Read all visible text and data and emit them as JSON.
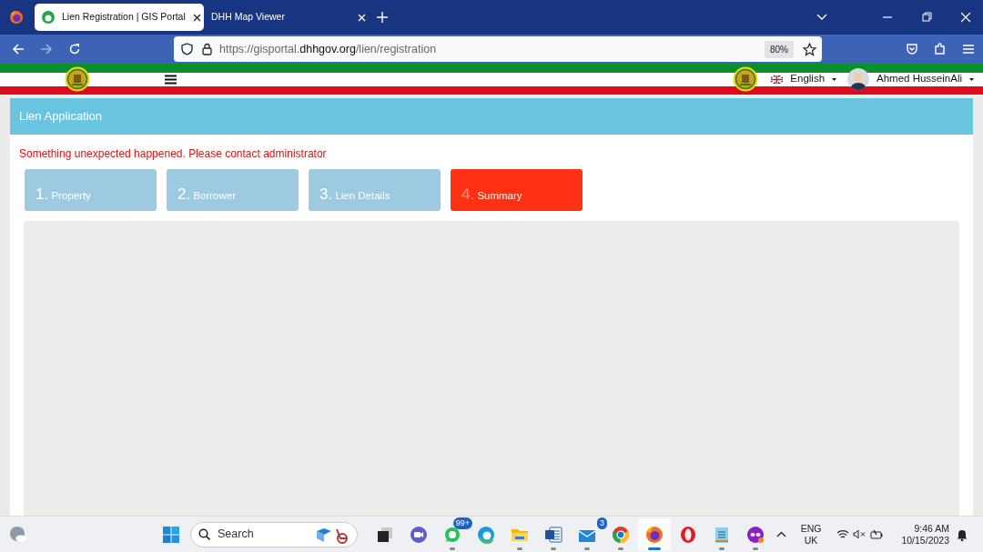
{
  "browser": {
    "tabs": [
      {
        "title": "Lien Registration | GIS Portal",
        "selected": true
      },
      {
        "title": "DHH Map Viewer",
        "selected": false
      }
    ],
    "url": {
      "prefix": "https://gisportal.",
      "domain": "dhhgov.org",
      "path": "/lien/registration"
    },
    "zoom": "80%"
  },
  "header": {
    "language": "English",
    "user": "Ahmed HusseinAli"
  },
  "card": {
    "title": "Lien Application",
    "error": "Something unexpected happened. Please contact administrator",
    "steps": [
      {
        "number": "1.",
        "label": "Property",
        "selected": false
      },
      {
        "number": "2.",
        "label": "Borrower",
        "selected": false
      },
      {
        "number": "3.",
        "label": "Lien Details",
        "selected": false
      },
      {
        "number": "4.",
        "label": "Summary",
        "selected": true
      }
    ]
  },
  "taskbar": {
    "search": "Search",
    "apps": [
      {
        "kind": "taskview",
        "running": false,
        "selected": false
      },
      {
        "kind": "meet",
        "running": false,
        "selected": false
      },
      {
        "kind": "whatsapp",
        "running": true,
        "selected": false,
        "badge": "99+"
      },
      {
        "kind": "edge",
        "running": false,
        "selected": false
      },
      {
        "kind": "folder",
        "running": true,
        "selected": false
      },
      {
        "kind": "word",
        "running": true,
        "selected": false
      },
      {
        "kind": "mail",
        "running": true,
        "selected": false,
        "badge": "3"
      },
      {
        "kind": "chrome",
        "running": true,
        "selected": false
      },
      {
        "kind": "firefox",
        "running": true,
        "selected": true
      },
      {
        "kind": "opera",
        "running": false,
        "selected": false
      },
      {
        "kind": "notepad",
        "running": true,
        "selected": false
      },
      {
        "kind": "mask",
        "running": true,
        "selected": false
      }
    ],
    "language": [
      "ENG",
      "UK"
    ],
    "time": "9:46 AM",
    "date": "10/15/2023"
  }
}
